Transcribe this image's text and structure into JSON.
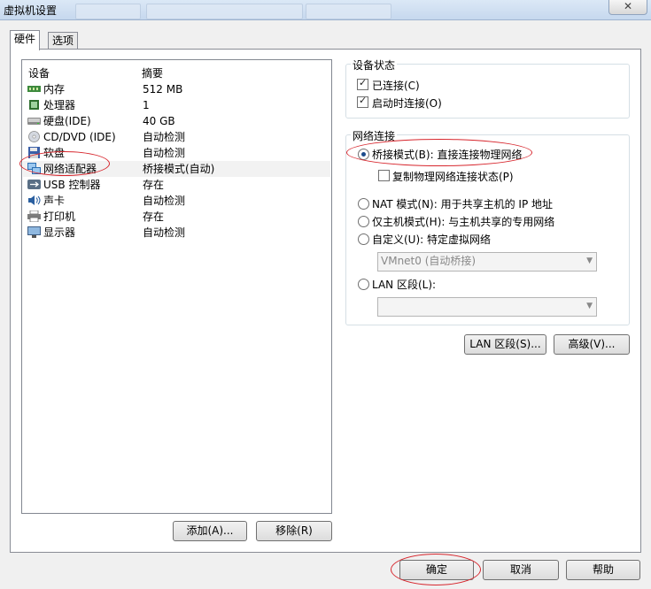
{
  "window": {
    "title": "虚拟机设置",
    "close_glyph": "✕"
  },
  "tabs": [
    {
      "label": "硬件"
    },
    {
      "label": "选项"
    }
  ],
  "device_list": {
    "headers": {
      "device": "设备",
      "summary": "摘要"
    },
    "rows": [
      {
        "name": "内存",
        "summary": "512 MB",
        "icon": "memory-icon"
      },
      {
        "name": "处理器",
        "summary": "1",
        "icon": "cpu-icon"
      },
      {
        "name": "硬盘(IDE)",
        "summary": "40 GB",
        "icon": "harddisk-icon"
      },
      {
        "name": "CD/DVD (IDE)",
        "summary": "自动检测",
        "icon": "cd-dvd-icon"
      },
      {
        "name": "软盘",
        "summary": "自动检测",
        "icon": "floppy-icon"
      },
      {
        "name": "网络适配器",
        "summary": "桥接模式(自动)",
        "icon": "network-adapter-icon",
        "selected": true
      },
      {
        "name": "USB 控制器",
        "summary": "存在",
        "icon": "usb-icon"
      },
      {
        "name": "声卡",
        "summary": "自动检测",
        "icon": "sound-card-icon"
      },
      {
        "name": "打印机",
        "summary": "存在",
        "icon": "printer-icon"
      },
      {
        "name": "显示器",
        "summary": "自动检测",
        "icon": "display-icon"
      }
    ],
    "add_button": "添加(A)...",
    "remove_button": "移除(R)"
  },
  "device_status": {
    "group_label": "设备状态",
    "connected": {
      "label": "已连接(C)",
      "checked": true
    },
    "connect_at_power_on": {
      "label": "启动时连接(O)",
      "checked": true
    }
  },
  "network": {
    "group_label": "网络连接",
    "bridged": {
      "label": "桥接模式(B): 直接连接物理网络",
      "selected": true
    },
    "replicate": {
      "label": "复制物理网络连接状态(P)",
      "checked": false
    },
    "nat": {
      "label": "NAT 模式(N): 用于共享主机的 IP 地址",
      "selected": false
    },
    "host_only": {
      "label": "仅主机模式(H): 与主机共享的专用网络",
      "selected": false
    },
    "custom": {
      "label": "自定义(U): 特定虚拟网络",
      "selected": false
    },
    "custom_select_value": "VMnet0 (自动桥接)",
    "lan_segment": {
      "label": "LAN 区段(L):",
      "selected": false
    },
    "lan_select_value": "",
    "lan_segments_button": "LAN 区段(S)...",
    "advanced_button": "高级(V)..."
  },
  "footer": {
    "ok": "确定",
    "cancel": "取消",
    "help": "帮助"
  },
  "colors": {
    "annotation_red": "#d7262d",
    "selection_bg": "#f2f2f2"
  }
}
